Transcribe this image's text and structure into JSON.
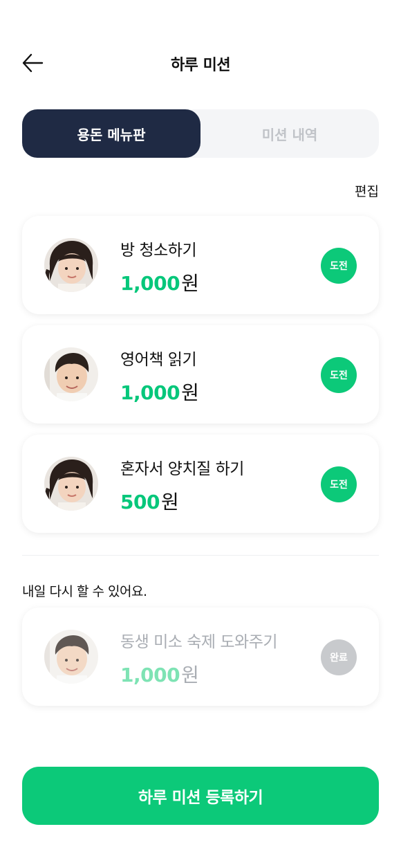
{
  "header": {
    "title": "하루 미션",
    "back_icon": "arrow-left-icon"
  },
  "tabs": [
    {
      "label": "용돈 메뉴판",
      "active": true
    },
    {
      "label": "미션 내역",
      "active": false
    }
  ],
  "edit_label": "편집",
  "missions": [
    {
      "title": "방 청소하기",
      "amount": "1,000",
      "unit": "원",
      "badge": "도전",
      "avatar": "girl-avatar"
    },
    {
      "title": "영어책 읽기",
      "amount": "1,000",
      "unit": "원",
      "badge": "도전",
      "avatar": "boy-avatar"
    },
    {
      "title": "혼자서 양치질 하기",
      "amount": "500",
      "unit": "원",
      "badge": "도전",
      "avatar": "girl-avatar"
    }
  ],
  "completed_section": {
    "note": "내일 다시 할 수 있어요.",
    "items": [
      {
        "title": "동생 미소 숙제 도와주기",
        "amount": "1,000",
        "unit": "원",
        "badge": "완료",
        "avatar": "boy-avatar"
      }
    ]
  },
  "cta_label": "하루 미션 등록하기",
  "colors": {
    "accent_green": "#0CC979",
    "navy": "#1F2A44",
    "done_gray": "#C8CACD"
  }
}
